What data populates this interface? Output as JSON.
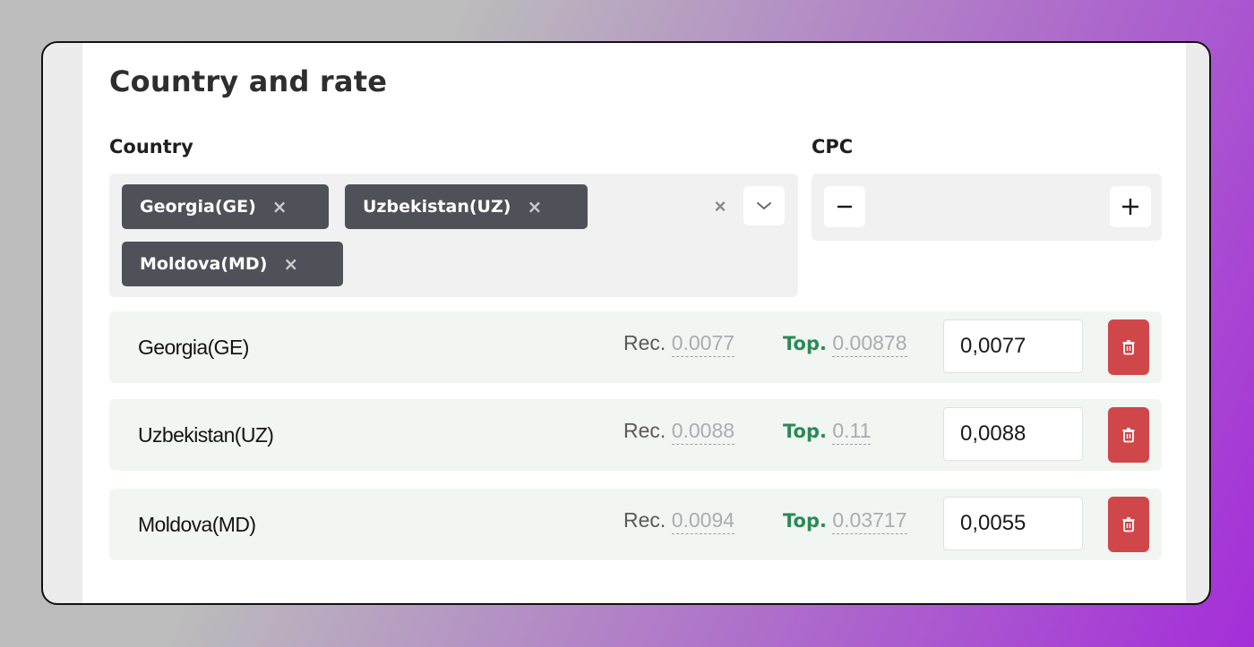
{
  "section": {
    "title": "Country and rate",
    "country_label": "Country",
    "cpc_label": "CPC"
  },
  "country_select": {
    "chips": [
      {
        "label": "Georgia(GE)",
        "remove": "×"
      },
      {
        "label": "Uzbekistan(UZ)",
        "remove": "×"
      },
      {
        "label": "Moldova(MD)",
        "remove": "×"
      }
    ],
    "clear_all": "×"
  },
  "cpc": {
    "minus": "−",
    "plus": "+"
  },
  "rates": [
    {
      "country": "Georgia(GE)",
      "rec_label": "Rec.",
      "rec_value": "0.0077",
      "top_label": "Top.",
      "top_value": "0.00878",
      "input_value": "0,0077"
    },
    {
      "country": "Uzbekistan(UZ)",
      "rec_label": "Rec.",
      "rec_value": "0.0088",
      "top_label": "Top.",
      "top_value": "0.11",
      "input_value": "0,0088"
    },
    {
      "country": "Moldova(MD)",
      "rec_label": "Rec.",
      "rec_value": "0.0094",
      "top_label": "Top.",
      "top_value": "0.03717",
      "input_value": "0,0055"
    }
  ],
  "colors": {
    "chip_bg": "#4e5258",
    "top_label": "#2a8a55",
    "delete_button": "#d0474a",
    "row_bg": "#f2f6f2"
  },
  "icons": {
    "chip_remove": "close-icon",
    "clear_all": "close-icon",
    "dropdown": "chevron-down-icon",
    "delete": "trash-icon"
  }
}
